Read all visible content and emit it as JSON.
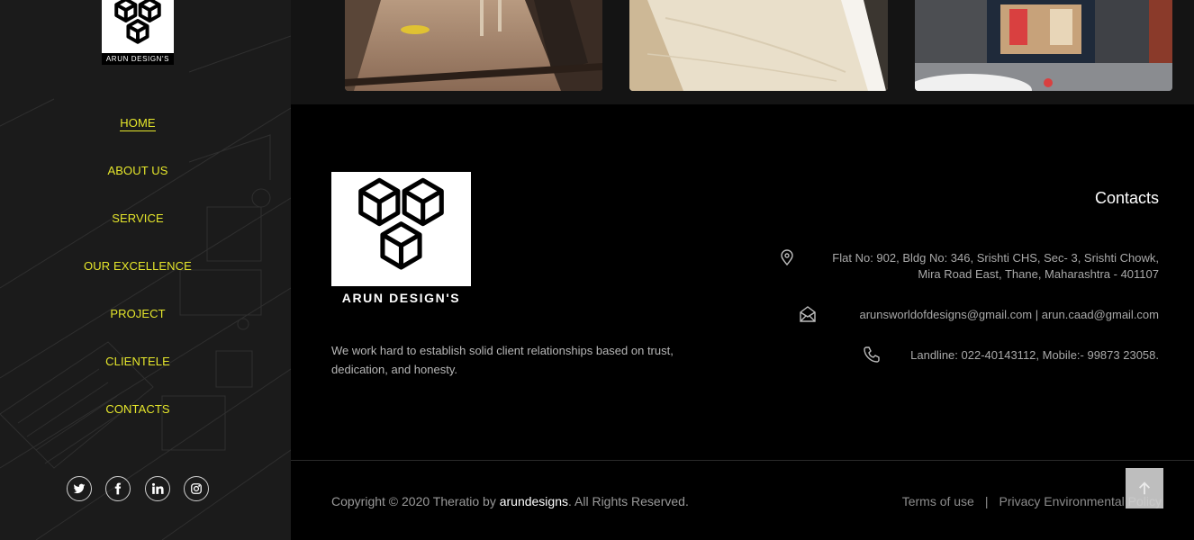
{
  "sidebar": {
    "logo_text": "ARUN DESIGN'S",
    "nav": [
      {
        "label": "HOME",
        "active": true
      },
      {
        "label": "ABOUT US",
        "active": false
      },
      {
        "label": "SERVICE",
        "active": false
      },
      {
        "label": "OUR EXCELLENCE",
        "active": false
      },
      {
        "label": "PROJECT",
        "active": false
      },
      {
        "label": "CLIENTELE",
        "active": false
      },
      {
        "label": "CONTACTS",
        "active": false
      }
    ],
    "social": [
      "twitter-icon",
      "facebook-icon",
      "linkedin-icon",
      "instagram-icon"
    ]
  },
  "footer": {
    "brand": "ARUN DESIGN'S",
    "tagline": "We work hard to establish solid client relationships based on trust, dedication, and honesty.",
    "contacts_title": "Contacts",
    "address_line1": "Flat No: 902, Bldg No: 346, Srishti CHS, Sec- 3, Srishti Chowk,",
    "address_line2": "Mira Road East, Thane, Maharashtra - 401107",
    "email": "arunsworldofdesigns@gmail.com | arun.caad@gmail.com",
    "phone": "Landline: 022-40143112, Mobile:- 99873 23058.",
    "copyright_prefix": "Copyright © 2020 Theratio by ",
    "copyright_brand": "arundesigns",
    "copyright_suffix": ". All Rights Reserved.",
    "links": [
      "Terms of use",
      "Privacy Environmental Policy"
    ]
  },
  "colors": {
    "accent": "#e5e62b",
    "sidebar_bg": "#1b1b1b",
    "footer_bg": "#000000"
  }
}
